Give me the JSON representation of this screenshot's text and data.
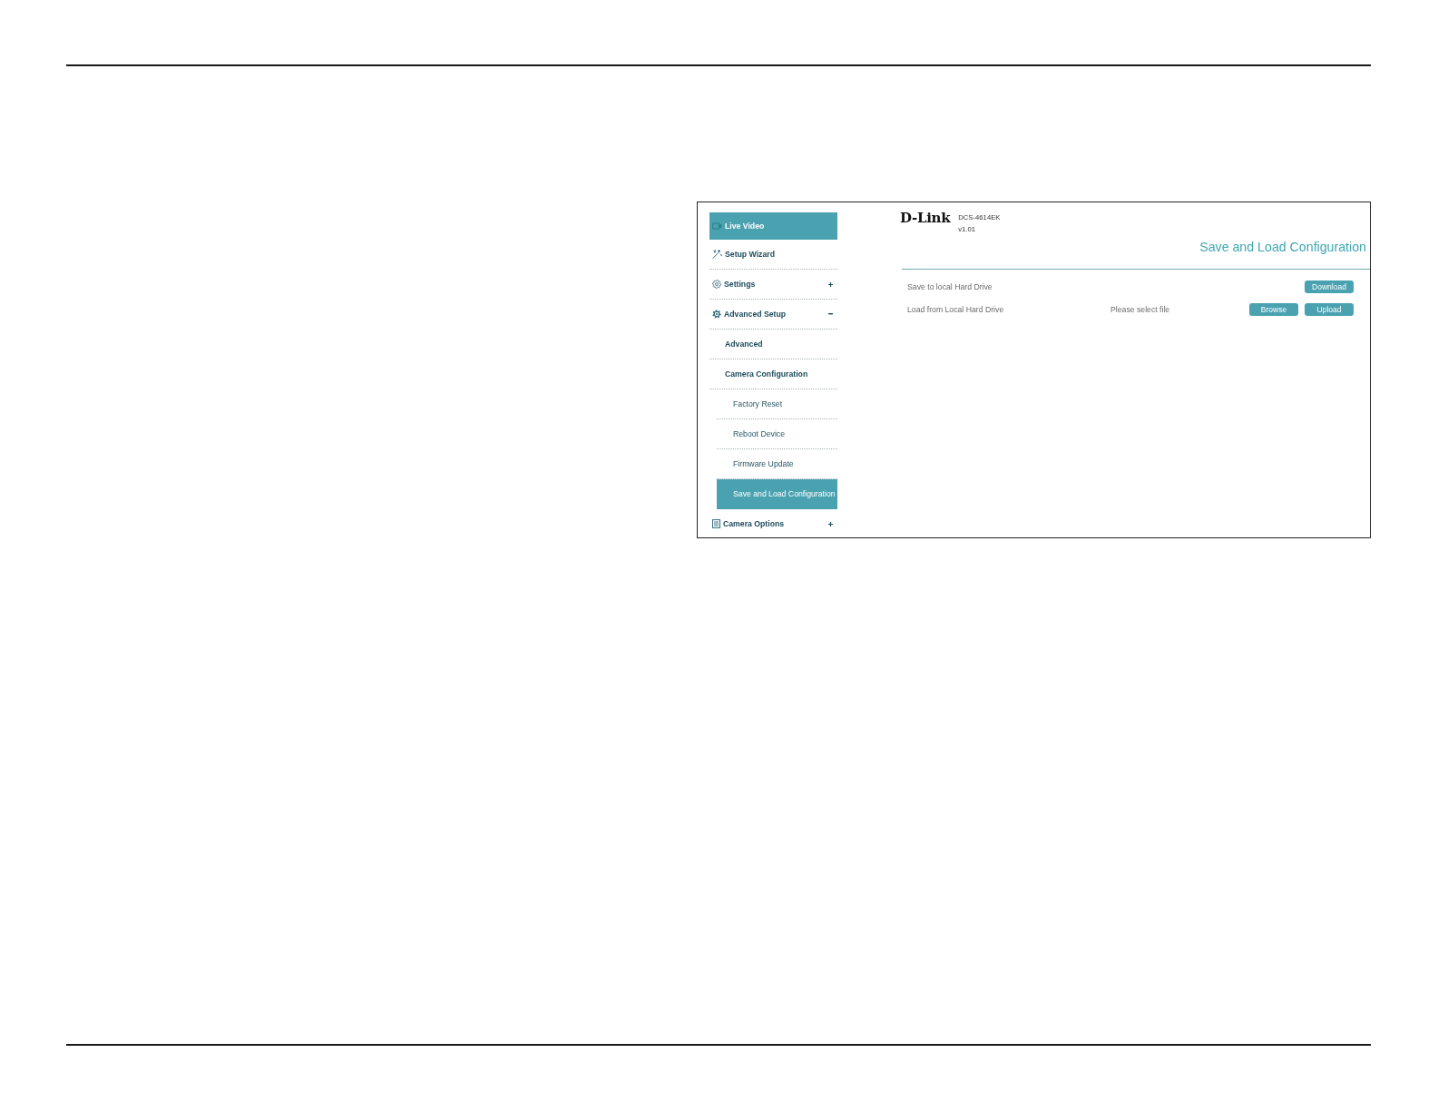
{
  "header": {
    "logo": "D-Link",
    "model": "DCS-4614EK",
    "version": "v1.01"
  },
  "sidebar": {
    "items": [
      {
        "label": "Live Video",
        "selected": true
      },
      {
        "label": "Setup Wizard",
        "selected": false
      },
      {
        "label": "Settings",
        "selected": false,
        "expanded": false
      },
      {
        "label": "Advanced Setup",
        "selected": false,
        "expanded": true,
        "children": [
          {
            "label": "Advanced",
            "selected": false
          },
          {
            "label": "Camera Configuration",
            "selected": false,
            "children": [
              {
                "label": "Factory Reset",
                "selected": false
              },
              {
                "label": "Reboot Device",
                "selected": false
              },
              {
                "label": "Firmware Update",
                "selected": false
              },
              {
                "label": "Save and Load Configuration",
                "selected": true
              }
            ]
          }
        ]
      },
      {
        "label": "Camera Options",
        "selected": false,
        "expanded": false
      }
    ]
  },
  "page": {
    "title": "Save and Load Configuration",
    "rows": [
      {
        "label": "Save to local Hard Drive",
        "buttons": [
          "Download"
        ]
      },
      {
        "label": "Load from Local Hard Drive",
        "file_status": "Please select file",
        "buttons": [
          "Browse",
          "Upload"
        ]
      }
    ]
  }
}
